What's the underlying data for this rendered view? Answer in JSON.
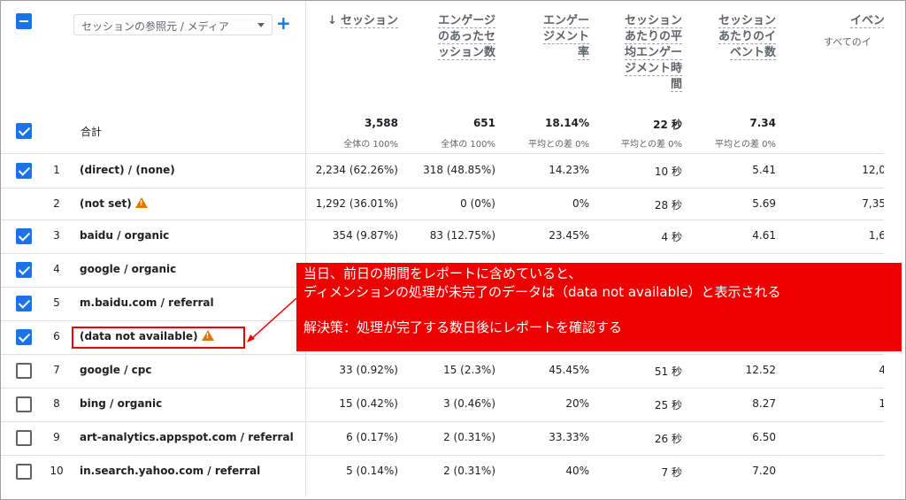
{
  "dimension_selector": {
    "label": "セッションの参照元 / メディア"
  },
  "columns": [
    {
      "key": "sessions",
      "lines": [
        "セッション"
      ],
      "sorted": true
    },
    {
      "key": "engaged",
      "lines": [
        "エンゲージ",
        "のあったセ",
        "ッション数"
      ]
    },
    {
      "key": "rate",
      "lines": [
        "エンゲー",
        "ジメント",
        "率"
      ]
    },
    {
      "key": "avg_time",
      "lines": [
        "セッション",
        "あたりの平",
        "均エンゲー",
        "ジメント時",
        "間"
      ]
    },
    {
      "key": "events_per",
      "lines": [
        "セッション",
        "あたりのイ",
        "ベント数"
      ]
    },
    {
      "key": "events",
      "lines": [
        "イベン"
      ],
      "sub": "すべてのイ"
    }
  ],
  "totals": {
    "label": "合計",
    "values": [
      "3,588",
      "651",
      "18.14%",
      "22 秒",
      "7.34"
    ],
    "subs": [
      "全体の 100%",
      "全体の 100%",
      "平均との差 0%",
      "平均との差 0%",
      "平均との差 0%"
    ]
  },
  "rows": [
    {
      "n": "1",
      "dim": "(direct) / (none)",
      "checked": true,
      "warn": false,
      "cells": [
        "2,234 (62.26%)",
        "318 (48.85%)",
        "14.23%",
        "10 秒",
        "5.41",
        "12,0"
      ]
    },
    {
      "n": "2",
      "dim": "(not set)",
      "checked": null,
      "warn": true,
      "cells": [
        "1,292 (36.01%)",
        "0 (0%)",
        "0%",
        "28 秒",
        "5.69",
        "7,35"
      ]
    },
    {
      "n": "3",
      "dim": "baidu / organic",
      "checked": true,
      "warn": false,
      "cells": [
        "354 (9.87%)",
        "83 (12.75%)",
        "23.45%",
        "4 秒",
        "4.61",
        "1,6"
      ]
    },
    {
      "n": "4",
      "dim": "google / organic",
      "checked": true,
      "warn": false,
      "cells": [
        "",
        "",
        "",
        "",
        "",
        ""
      ]
    },
    {
      "n": "5",
      "dim": "m.baidu.com / referral",
      "checked": true,
      "warn": false,
      "cells": [
        "",
        "",
        "",
        "",
        "",
        ""
      ]
    },
    {
      "n": "6",
      "dim": "(data not available)",
      "checked": true,
      "warn": true,
      "cells": [
        "",
        "",
        "",
        "",
        "",
        ""
      ]
    },
    {
      "n": "7",
      "dim": "google / cpc",
      "checked": false,
      "warn": false,
      "cells": [
        "33 (0.92%)",
        "15 (2.3%)",
        "45.45%",
        "51 秒",
        "12.52",
        "4"
      ]
    },
    {
      "n": "8",
      "dim": "bing / organic",
      "checked": false,
      "warn": false,
      "cells": [
        "15 (0.42%)",
        "3 (0.46%)",
        "20%",
        "25 秒",
        "8.27",
        "1"
      ]
    },
    {
      "n": "9",
      "dim": "art-analytics.appspot.com / referral",
      "checked": false,
      "warn": false,
      "cells": [
        "6 (0.17%)",
        "2 (0.31%)",
        "33.33%",
        "26 秒",
        "6.50",
        ""
      ]
    },
    {
      "n": "10",
      "dim": "in.search.yahoo.com / referral",
      "checked": false,
      "warn": false,
      "cells": [
        "5 (0.14%)",
        "2 (0.31%)",
        "40%",
        "7 秒",
        "7.20",
        ""
      ]
    }
  ],
  "callout": {
    "line1": "当日、前日の期間をレポートに含めていると、",
    "line2": "ディメンションの処理が未完了のデータは（data not available）と表示される",
    "line3": "解決策：処理が完了する数日後にレポートを確認する"
  },
  "colors": {
    "accent": "#1a73e8",
    "callout": "#ee0000",
    "warning": "#e37400"
  }
}
